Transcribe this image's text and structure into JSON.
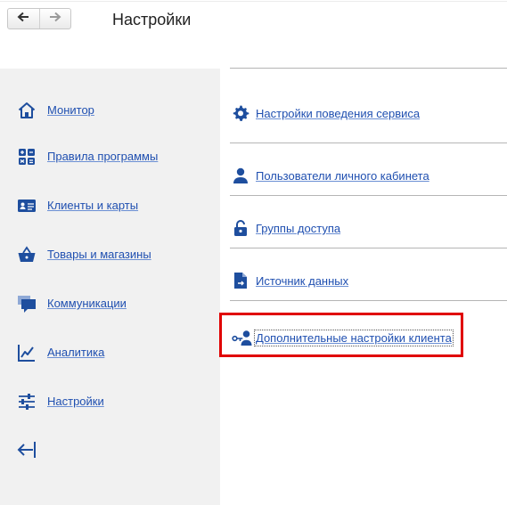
{
  "header": {
    "title": "Настройки",
    "back_icon": "arrow-left-icon",
    "forward_icon": "arrow-right-icon"
  },
  "sidebar": {
    "items": [
      {
        "label": "Монитор",
        "icon": "home-icon"
      },
      {
        "label": "Правила программы",
        "icon": "calculator-icon"
      },
      {
        "label": "Клиенты и карты",
        "icon": "id-card-icon"
      },
      {
        "label": "Товары и магазины",
        "icon": "basket-icon"
      },
      {
        "label": "Коммуникации",
        "icon": "chat-icon"
      },
      {
        "label": "Аналитика",
        "icon": "chart-icon"
      },
      {
        "label": "Настройки",
        "icon": "sliders-icon"
      }
    ],
    "collapse_icon": "collapse-left-icon"
  },
  "main": {
    "items": [
      {
        "label": "Настройки поведения сервиса",
        "icon": "gear-icon"
      },
      {
        "label": "Пользователи личного кабинета",
        "icon": "user-icon"
      },
      {
        "label": "Группы доступа",
        "icon": "lock-icon"
      },
      {
        "label": "Источник данных",
        "icon": "document-icon"
      },
      {
        "label": "Дополнительные настройки клиента",
        "icon": "user-key-icon"
      }
    ]
  },
  "colors": {
    "link": "#1f4fb0",
    "icon": "#1e4e9e",
    "highlight": "#e00000",
    "sidebar_bg": "#f1f1f1"
  }
}
